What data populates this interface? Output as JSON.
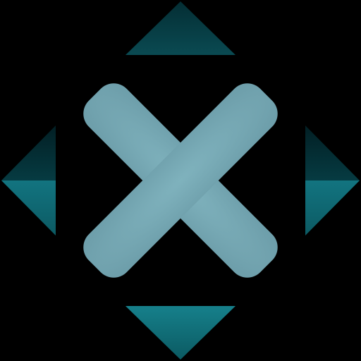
{
  "icon": {
    "name": "move-cross-icon",
    "center_mark": "x-mark",
    "direction_arrows": [
      "up",
      "left",
      "right",
      "down"
    ]
  },
  "colors": {
    "background": "#000000",
    "x_mark": "#77AAB6",
    "arrow_dark": "#05383F",
    "arrow_mid": "#0C5A63",
    "arrow_bright": "#14707A"
  }
}
